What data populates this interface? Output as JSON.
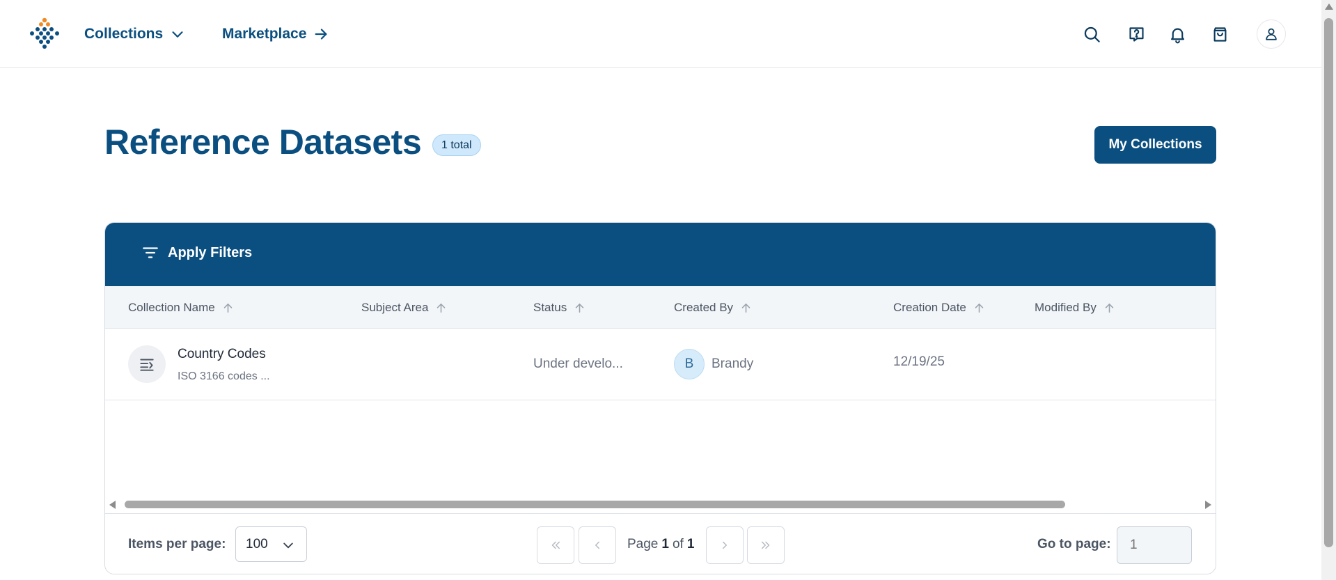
{
  "nav": {
    "collections_label": "Collections",
    "marketplace_label": "Marketplace",
    "icons": [
      "search-icon",
      "help-chat-icon",
      "bell-icon",
      "shopping-bag-icon",
      "user-icon"
    ]
  },
  "header": {
    "title": "Reference Datasets",
    "total_badge": "1 total",
    "my_collections_label": "My Collections"
  },
  "filters": {
    "apply_label": "Apply Filters"
  },
  "table": {
    "columns": [
      "Collection Name",
      "Subject Area",
      "Status",
      "Created By",
      "Creation Date",
      "Modified By"
    ],
    "rows": [
      {
        "name": "Country Codes",
        "description": "ISO 3166 codes ...",
        "subject_area": "",
        "status": "Under develo...",
        "creator_initial": "B",
        "creator": "Brandy",
        "creation_date": "12/19/25",
        "modified_by": ""
      }
    ]
  },
  "pagination": {
    "items_per_page_label": "Items per page:",
    "items_per_page_value": "100",
    "page_word": "Page",
    "current_page": "1",
    "of_word": "of",
    "total_pages": "1",
    "goto_label": "Go to page:",
    "goto_placeholder": "1"
  },
  "colors": {
    "brand": "#0b4f80",
    "accent_orange": "#f08a24",
    "badge_bg": "#cfe8fb"
  }
}
